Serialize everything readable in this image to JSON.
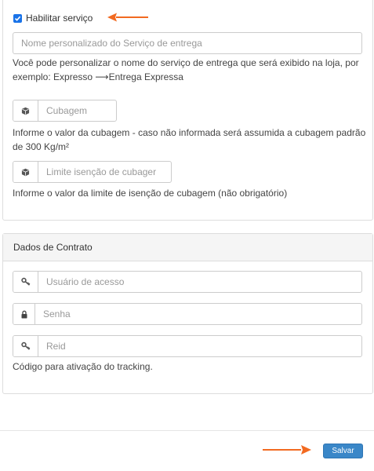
{
  "service": {
    "enable_label": "Habilitar serviço",
    "enabled": true,
    "name_placeholder": "Nome personalizado do Serviço de entrega",
    "name_help_line1": "Você pode personalizar o nome do serviço de entrega que será exibido na loja, por",
    "name_help_line2": "exemplo: Expresso ⟶Entrega Expressa",
    "cubage_placeholder": "Cubagem",
    "cubage_help_line1": "Informe o valor da cubagem - caso não informada será assumida a cubagem padrão",
    "cubage_help_line2": "de 300 Kg/m²",
    "cubage_limit_placeholder": "Limite isenção de cubager",
    "cubage_limit_help": "Informe o valor da limite de isenção de cubagem (não obrigatório)"
  },
  "contract": {
    "title": "Dados de Contrato",
    "user_placeholder": "Usuário de acesso",
    "password_placeholder": "Senha",
    "reid_placeholder": "Reid",
    "reid_help": "Código para ativação do tracking."
  },
  "footer": {
    "save_label": "Salvar"
  },
  "colors": {
    "accent_arrow": "#f26a21",
    "save_button": "#3a87c8",
    "checkbox": "#1a73e8"
  },
  "icons": {
    "cubage": "cube-icon",
    "cubage_limit": "cube-icon",
    "user": "key-icon",
    "password": "lock-icon",
    "reid": "key-icon"
  }
}
